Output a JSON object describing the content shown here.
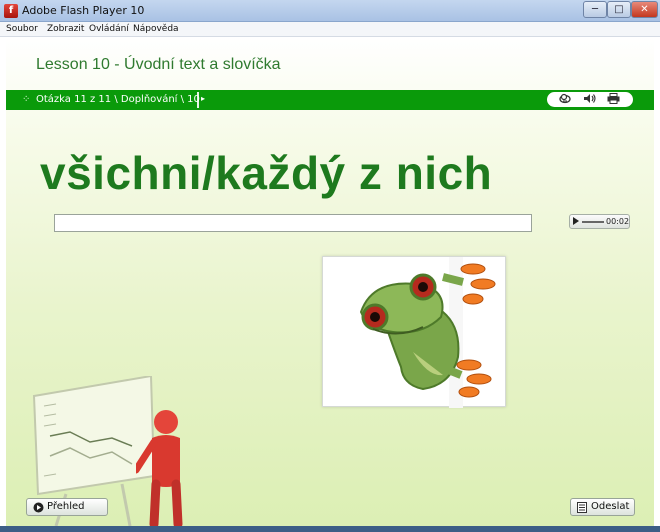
{
  "window": {
    "title": "Adobe Flash Player 10",
    "app_icon_letter": "f",
    "controls": {
      "minimize": "─",
      "maximize": "□",
      "close": "✕"
    }
  },
  "menu": {
    "items": [
      "Soubor",
      "Zobrazit",
      "Ovládání",
      "Nápověda"
    ]
  },
  "lesson": {
    "title": "Lesson 10 - Úvodní text a slovíčka",
    "breadcrumb": "Otázka 11 z 11 \\ Doplňování \\ 10",
    "toolbar_icons": [
      "cloud-icon",
      "speaker-icon",
      "printer-icon"
    ]
  },
  "question": {
    "word": "všichni/každý z nich",
    "answer_value": "",
    "audio_time": "00:02"
  },
  "footer": {
    "overview_label": "Přehled",
    "submit_label": "Odeslat"
  },
  "colors": {
    "accent_green": "#0a9a0a",
    "word_green": "#1e7a1e",
    "title_green": "#2f7a2f"
  }
}
